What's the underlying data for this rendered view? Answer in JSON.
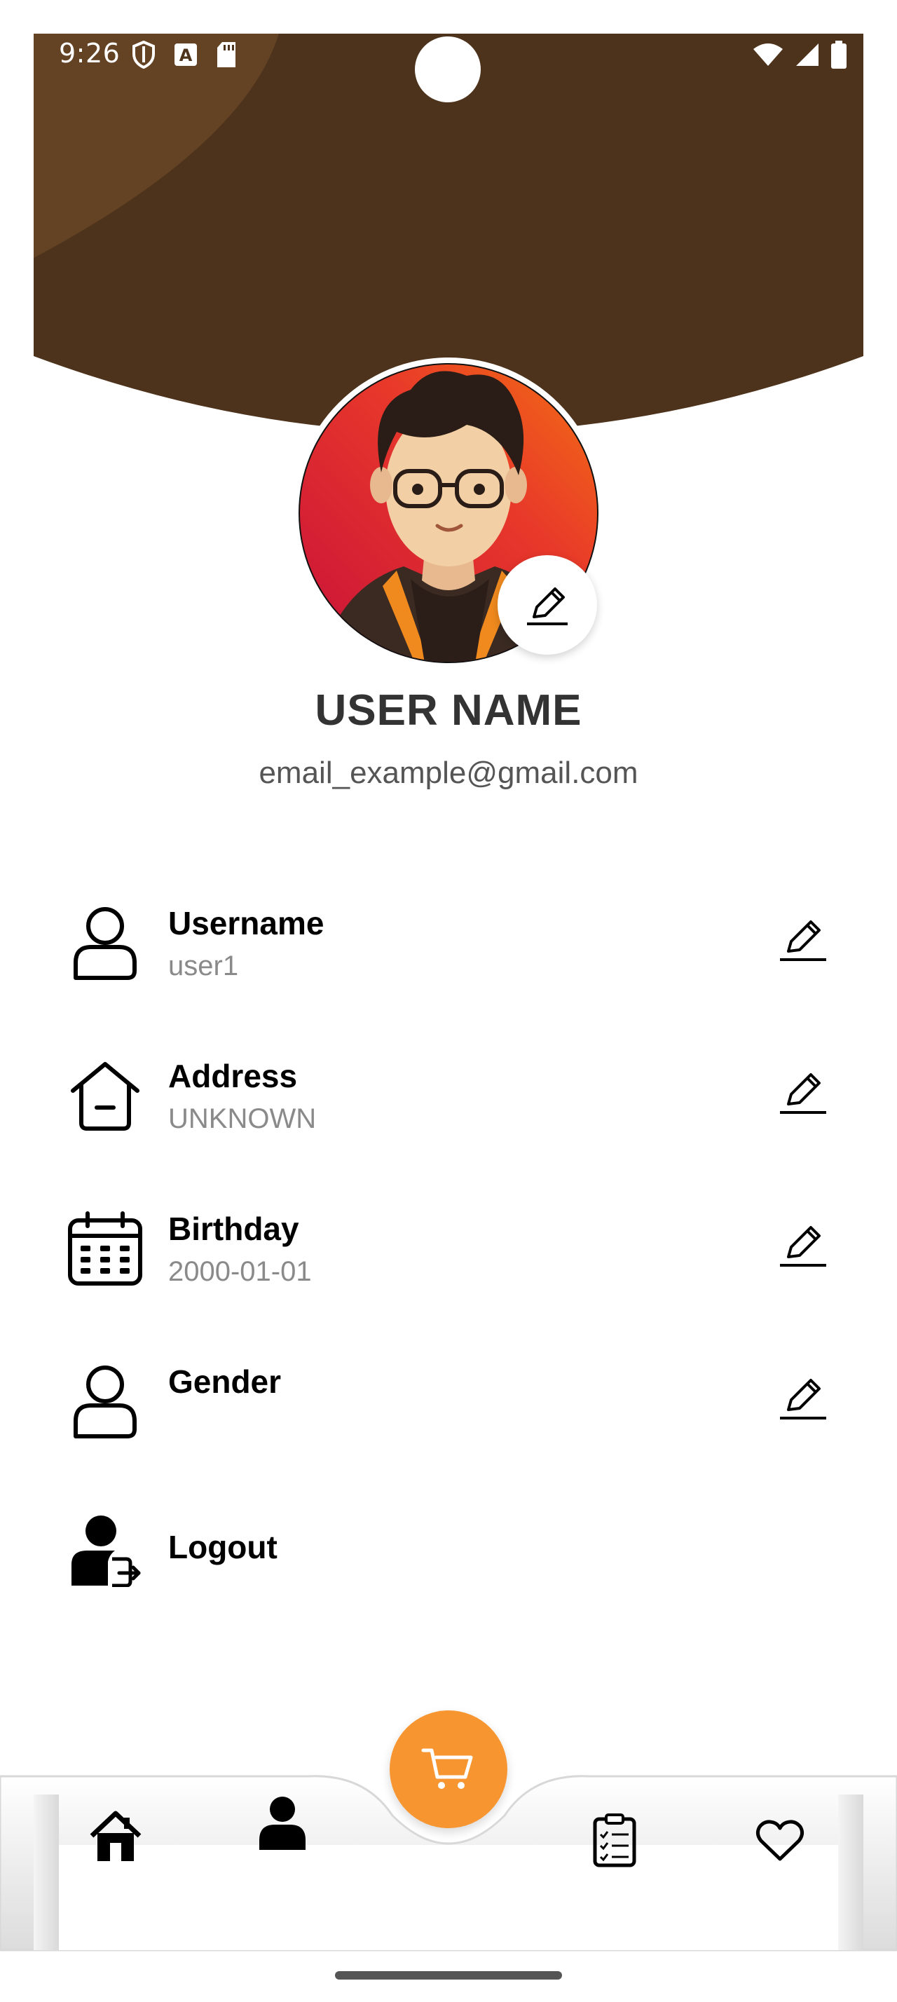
{
  "status_bar": {
    "time": "9:26",
    "left_icons": [
      "shield-icon",
      "a-box-icon",
      "sd-card-icon"
    ],
    "right_icons": [
      "wifi-icon",
      "signal-icon",
      "battery-icon"
    ]
  },
  "colors": {
    "header_brown": "#4d331b",
    "header_light_brown": "#644325",
    "accent_orange": "#f79530",
    "text_dark": "#333333",
    "text_gray": "#8a8a8a"
  },
  "profile": {
    "name": "USER NAME",
    "email": "email_example@gmail.com",
    "avatar_icon": "avatar-cartoon-icon",
    "edit_icon": "pencil-icon"
  },
  "fields": [
    {
      "label": "Username",
      "value": "user1",
      "icon": "user-outline-icon"
    },
    {
      "label": "Address",
      "value": "UNKNOWN",
      "icon": "house-icon"
    },
    {
      "label": "Birthday",
      "value": "2000-01-01",
      "icon": "calendar-icon"
    },
    {
      "label": "Gender",
      "value": "",
      "icon": "user-outline-icon"
    }
  ],
  "logout": {
    "label": "Logout",
    "icon": "user-logout-icon"
  },
  "bottom_nav": {
    "items": [
      "home-icon",
      "profile-icon",
      "cart-icon",
      "orders-clipboard-icon",
      "heart-icon"
    ]
  }
}
